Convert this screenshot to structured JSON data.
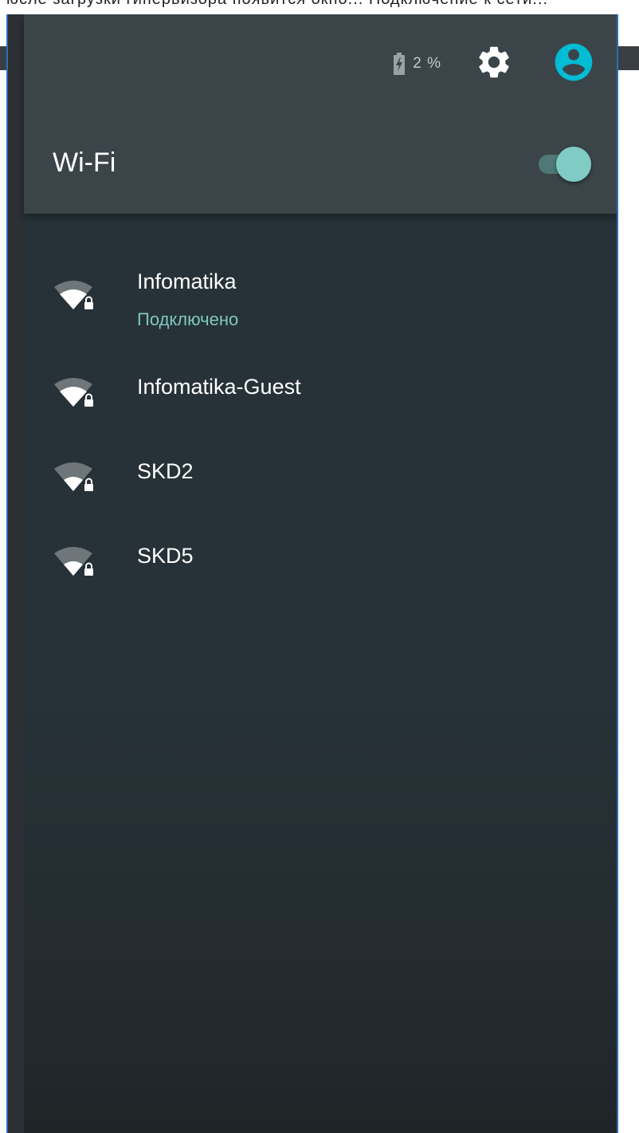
{
  "top_strip_text": "юсле загрузки гипервизора появится окно... Подключение к сети...",
  "status_bar": {
    "battery_percent": "2 %",
    "battery_icon": "battery-charging-icon",
    "settings_icon": "gear-icon",
    "account_icon": "account-circle-icon"
  },
  "header": {
    "title": "Wi-Fi",
    "toggle_state": "on"
  },
  "networks": [
    {
      "name": "Infomatika",
      "status": "Подключено",
      "icon": "wifi-lock-icon",
      "signal_level": 3,
      "signal_max": 4
    },
    {
      "name": "Infomatika-Guest",
      "status": "",
      "icon": "wifi-lock-icon",
      "signal_level": 3,
      "signal_max": 4
    },
    {
      "name": "SKD2",
      "status": "",
      "icon": "wifi-lock-icon",
      "signal_level": 2,
      "signal_max": 4
    },
    {
      "name": "SKD5",
      "status": "",
      "icon": "wifi-lock-icon",
      "signal_level": 2,
      "signal_max": 4
    }
  ],
  "colors": {
    "header_bg": "#3b4449",
    "panel_bg": "#263238",
    "accent": "#80cbc4",
    "account_icon": "#00bcd4",
    "connected_text": "#7fc8be"
  }
}
